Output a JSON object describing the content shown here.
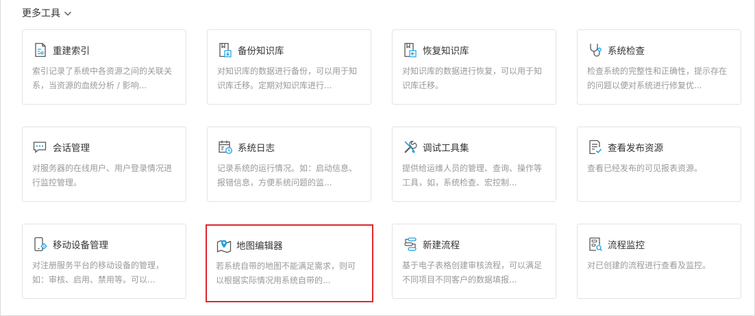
{
  "section": {
    "title": "更多工具"
  },
  "cards": [
    {
      "title": "重建索引",
      "desc": "索引记录了系统中各资源之间的关联关系，当资源的血统分析 / 影响...",
      "icon": "rebuild-index-icon"
    },
    {
      "title": "备份知识库",
      "desc": "对知识库的数据进行备份，可以用于知识库迁移。定期对知识库进行...",
      "icon": "backup-repository-icon"
    },
    {
      "title": "恢复知识库",
      "desc": "对知识库的数据进行恢复，可以用于知识库迁移。",
      "icon": "restore-repository-icon"
    },
    {
      "title": "系统检查",
      "desc": "检查系统的完整性和正确性，提示存在的问题以便对系统进行修复优...",
      "icon": "stethoscope-icon"
    },
    {
      "title": "会话管理",
      "desc": "对服务器的在线用户、用户登录情况进行监控管理。",
      "icon": "chat-icon"
    },
    {
      "title": "系统日志",
      "desc": "记录系统的运行情况。如：启动信息、报错信息，方便系统问题的监...",
      "icon": "calendar-clock-icon"
    },
    {
      "title": "调试工具集",
      "desc": "提供给运维人员的管理、查询、操作等工具，如，系统检查、宏控制...",
      "icon": "tools-icon"
    },
    {
      "title": "查看发布资源",
      "desc": "查看已经发布的可见报表资源。",
      "icon": "document-check-icon"
    },
    {
      "title": "移动设备管理",
      "desc": "对注册服务平台的移动设备的管理，如：审核、启用、禁用等。可以...",
      "icon": "mobile-gear-icon"
    },
    {
      "title": "地图编辑器",
      "desc": "若系统自带的地图不能满足需求，则可以根据实际情况用系统自带的...",
      "icon": "map-pin-icon"
    },
    {
      "title": "新建流程",
      "desc": "基于电子表格创建审核流程，可以满足不同项目不同客户的数据填报...",
      "icon": "workflow-icon"
    },
    {
      "title": "流程监控",
      "desc": "对已创建的流程进行查看及监控。",
      "icon": "flow-monitor-icon"
    }
  ],
  "colors": {
    "accent": "#1ba1e2",
    "icon": "#555555",
    "selected_border": "#e0242d"
  }
}
